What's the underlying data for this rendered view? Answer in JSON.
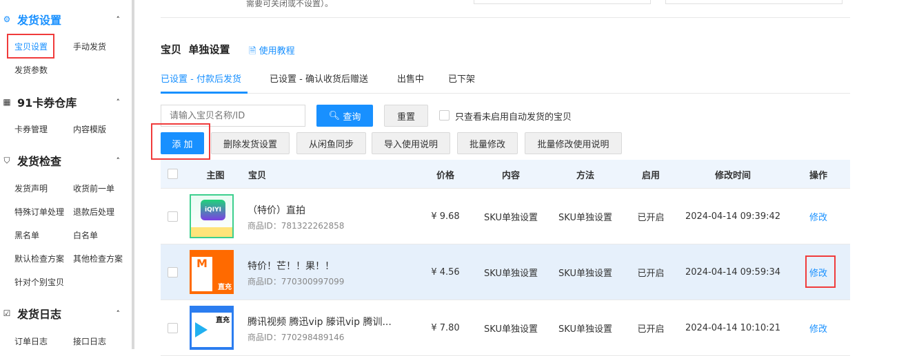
{
  "sidebar": {
    "sections": [
      {
        "title": "发货设置",
        "icon": "gear-icon",
        "items": [
          "宝贝设置",
          "手动发货",
          "发货参数"
        ]
      },
      {
        "title": "91卡券仓库",
        "icon": "qrcode-icon",
        "items": [
          "卡券管理",
          "内容模版"
        ]
      },
      {
        "title": "发货检查",
        "icon": "shield-icon",
        "items": [
          "发货声明",
          "收货前一单",
          "特殊订单处理",
          "退款后处理",
          "黑名单",
          "白名单",
          "默认检查方案",
          "其他检查方案",
          "针对个别宝贝"
        ]
      },
      {
        "title": "发货日志",
        "icon": "log-icon",
        "items": [
          "订单日志",
          "接口日志"
        ]
      }
    ]
  },
  "top_note": "需要可关闭或不设置）。",
  "section": {
    "title_a": "宝贝",
    "title_b": "单独设置",
    "tutorial": "使用教程"
  },
  "tabs": [
    "已设置 - 付款后发货",
    "已设置 - 确认收货后赠送",
    "出售中",
    "已下架"
  ],
  "search": {
    "placeholder": "请输入宝贝名称/ID",
    "query": "查询",
    "reset": "重置",
    "filter_label": "只查看未启用自动发货的宝贝"
  },
  "actions": [
    "添 加",
    "删除发货设置",
    "从闲鱼同步",
    "导入使用说明",
    "批量修改",
    "批量修改使用说明"
  ],
  "table": {
    "headers": [
      "主图",
      "宝贝",
      "价格",
      "内容",
      "方法",
      "启用",
      "修改时间",
      "操作"
    ],
    "rows": [
      {
        "title": "（特价）直拍",
        "id": "商品ID：781322262858",
        "price": "¥ 9.68",
        "content": "SKU单独设置",
        "method": "SKU单独设置",
        "enabled": "已开启",
        "time": "2024-04-14 09:39:42",
        "op": "修改",
        "thumb": "iQIYI"
      },
      {
        "title": "特价！芒！！果！！",
        "id": "商品ID：770300997099",
        "price": "¥ 4.56",
        "content": "SKU单独设置",
        "method": "SKU单独设置",
        "enabled": "已开启",
        "time": "2024-04-14 09:59:34",
        "op": "修改",
        "thumb": "直充"
      },
      {
        "title": "腾讯视频 腾迅vip 滕讯vip 腾训...",
        "id": "商品ID：770298489146",
        "price": "¥ 7.80",
        "content": "SKU单独设置",
        "method": "SKU单独设置",
        "enabled": "已开启",
        "time": "2024-04-14 10:10:21",
        "op": "修改",
        "thumb": "直充"
      }
    ]
  },
  "colors": {
    "accent": "#1890ff",
    "highlight": "#f03a3a",
    "row_selected": "#e6f0fb"
  }
}
